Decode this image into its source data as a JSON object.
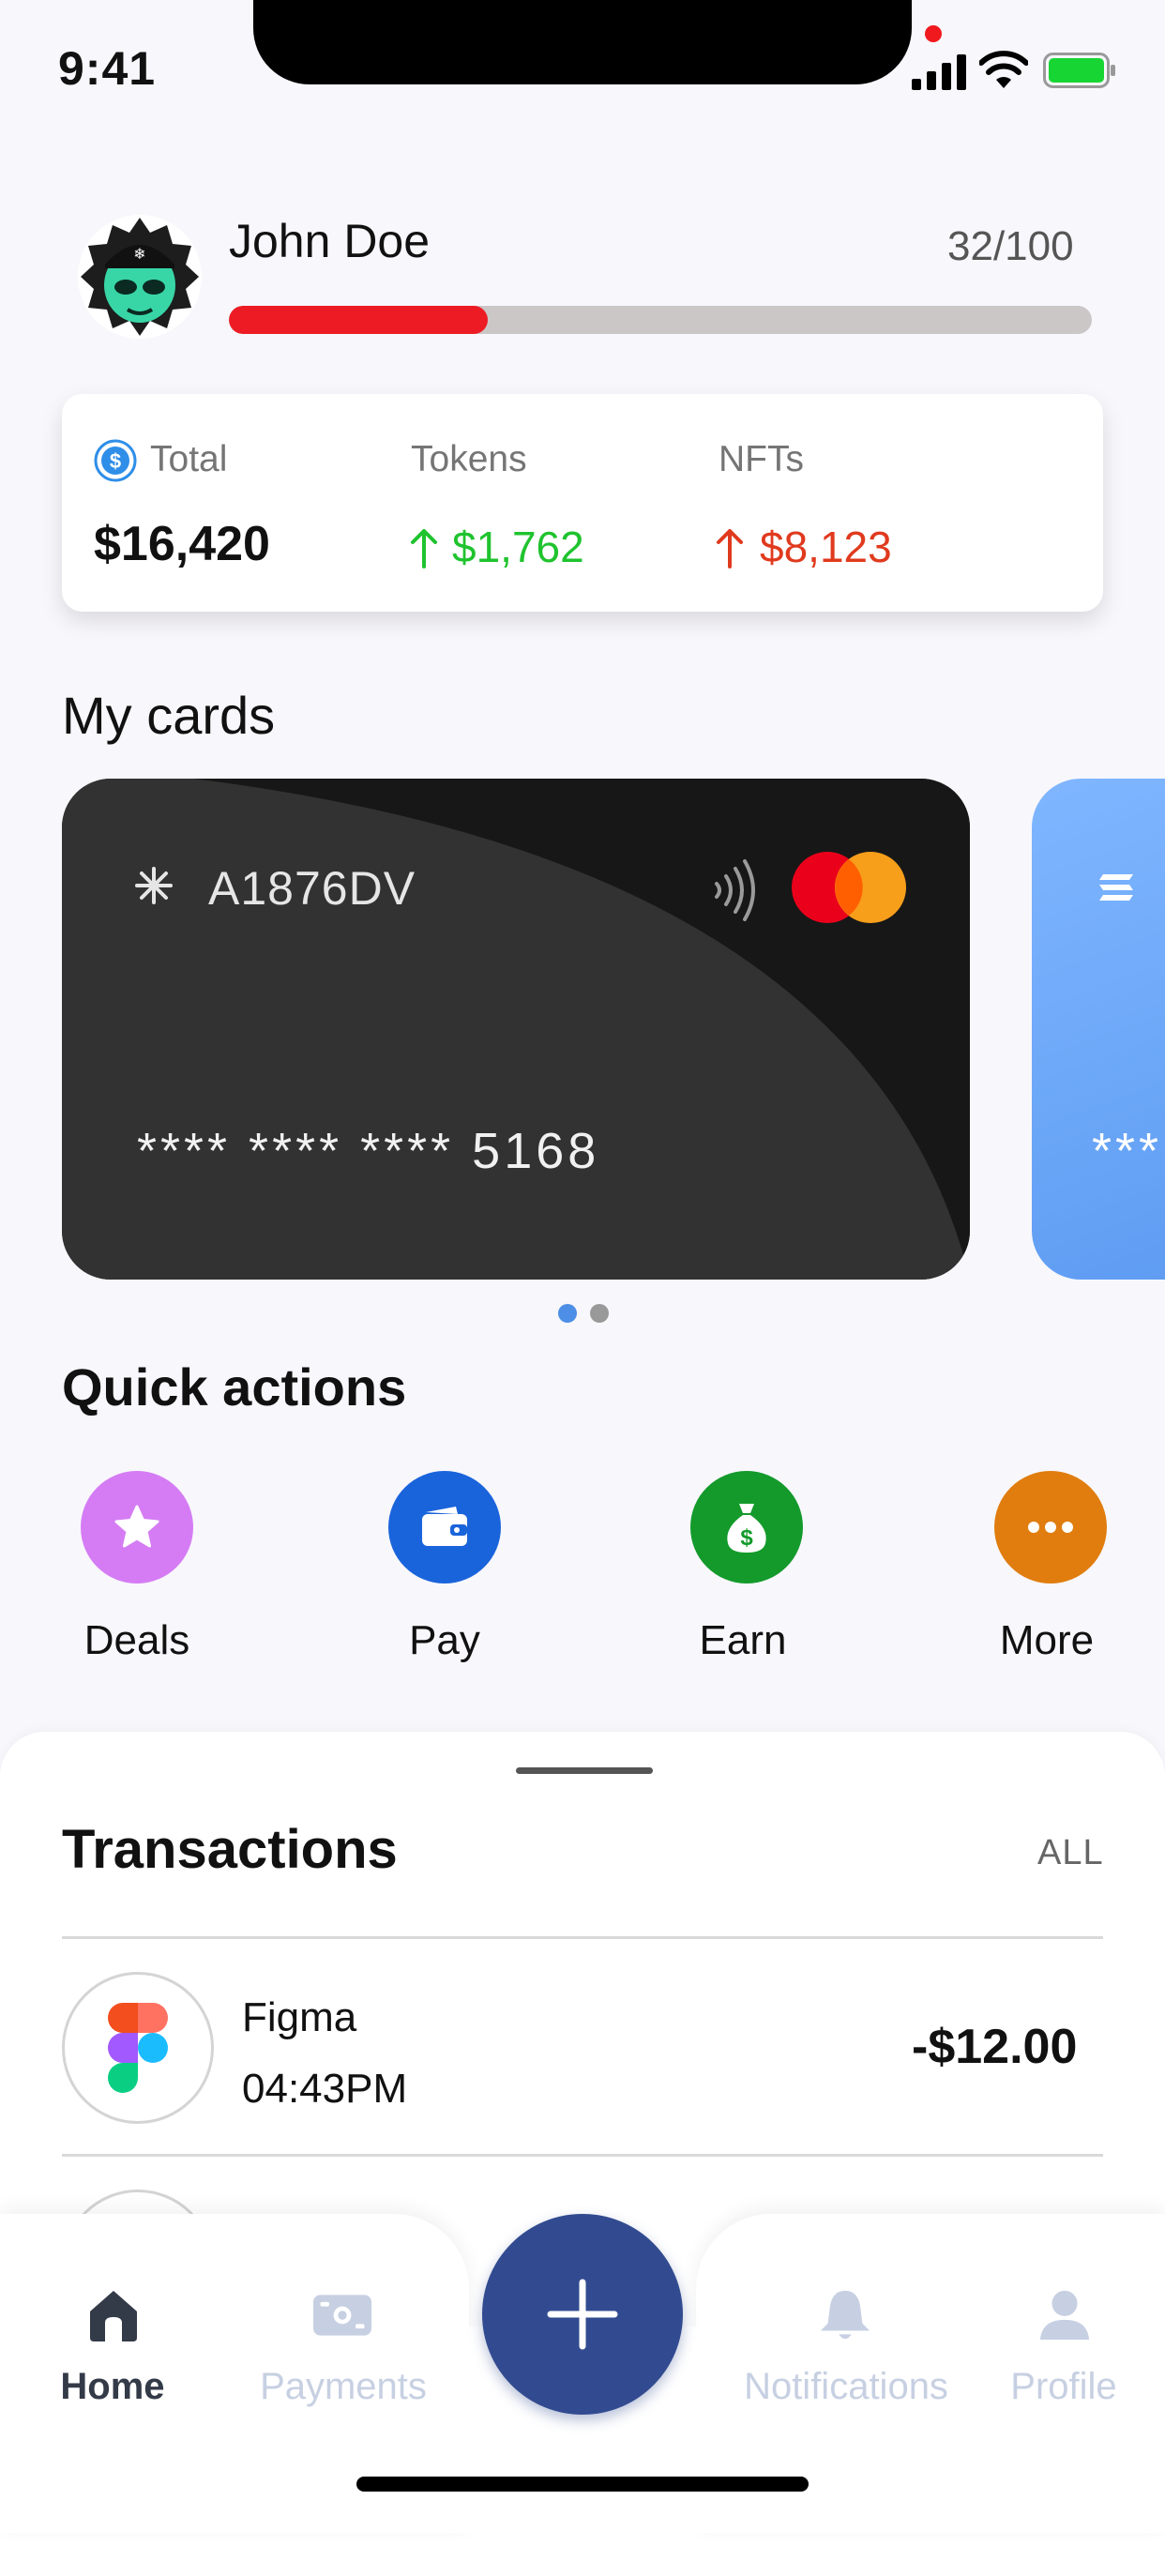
{
  "status_bar": {
    "time": "9:41"
  },
  "profile": {
    "name": "John Doe",
    "level_text": "32/100",
    "progress": 0.3
  },
  "summary": {
    "total_label": "Total",
    "total_value": "$16,420",
    "tokens_label": "Tokens",
    "tokens_value": "$1,762",
    "nfts_label": "NFTs",
    "nfts_value": "$8,123",
    "colors": {
      "tokens": "#1fc32e",
      "nfts": "#e03a1e",
      "dollar_icon": "#2f8ee8"
    }
  },
  "cards": {
    "title": "My cards",
    "items": [
      {
        "id": "A1876DV",
        "number": "**** **** **** 5168",
        "brand_icon": "mastercard-icon"
      },
      {
        "number": "***"
      }
    ],
    "active_index": 0
  },
  "quick_actions": {
    "title": "Quick actions",
    "items": [
      {
        "label": "Deals",
        "icon": "star-icon",
        "color": "#d57cf4"
      },
      {
        "label": "Pay",
        "icon": "wallet-icon",
        "color": "#1a64db"
      },
      {
        "label": "Earn",
        "icon": "money-bag-icon",
        "color": "#139a2b"
      },
      {
        "label": "More",
        "icon": "more-icon",
        "color": "#e07d0e"
      }
    ]
  },
  "transactions": {
    "title": "Transactions",
    "all_label": "ALL",
    "items": [
      {
        "name": "Figma",
        "time": "04:43PM",
        "amount": "-$12.00",
        "icon": "figma-icon"
      }
    ]
  },
  "nav": {
    "items": [
      {
        "label": "Home",
        "icon": "home-icon",
        "active": true
      },
      {
        "label": "Payments",
        "icon": "payments-icon",
        "active": false
      },
      {
        "label": "Notifications",
        "icon": "bell-icon",
        "active": false
      },
      {
        "label": "Profile",
        "icon": "profile-icon",
        "active": false
      }
    ],
    "fab_icon": "plus-icon",
    "colors": {
      "active": "#333a48",
      "inactive": "#c7d0e2"
    }
  }
}
